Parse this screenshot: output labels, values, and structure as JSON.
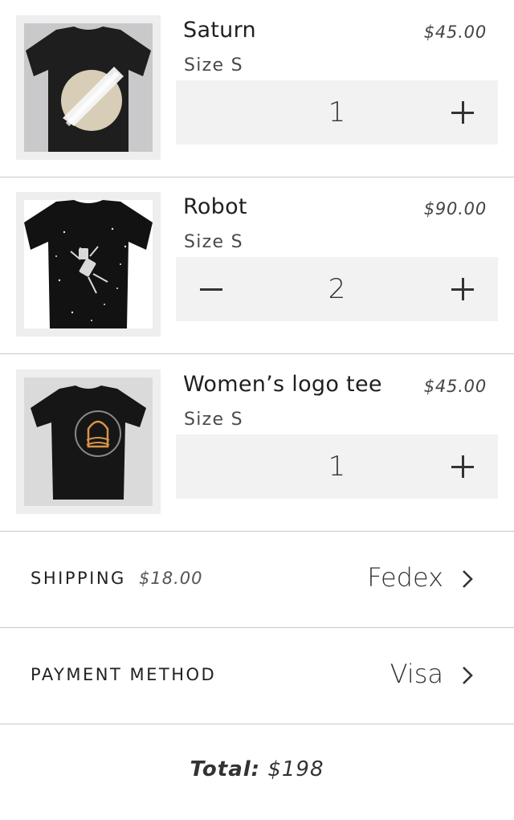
{
  "cart": {
    "items": [
      {
        "name": "Saturn",
        "price": "$45.00",
        "size": "Size S",
        "quantity": "1",
        "icon": "saturn-tshirt-image"
      },
      {
        "name": "Robot",
        "price": "$90.00",
        "size": "Size S",
        "quantity": "2",
        "icon": "robot-tshirt-image"
      },
      {
        "name": "Women’s logo tee",
        "price": "$45.00",
        "size": "Size S",
        "quantity": "1",
        "icon": "logo-tshirt-image"
      }
    ]
  },
  "shipping": {
    "label": "SHIPPING",
    "cost": "$18.00",
    "carrier": "Fedex"
  },
  "payment": {
    "label": "PAYMENT METHOD",
    "method": "Visa"
  },
  "total": {
    "label": "Total:",
    "amount": "$198"
  },
  "colors": {
    "divider": "#c8c8c8",
    "stepper_bg": "#f2f2f2",
    "thumb_bg": "#eeeeee",
    "shirt": "#1b1b1b"
  }
}
